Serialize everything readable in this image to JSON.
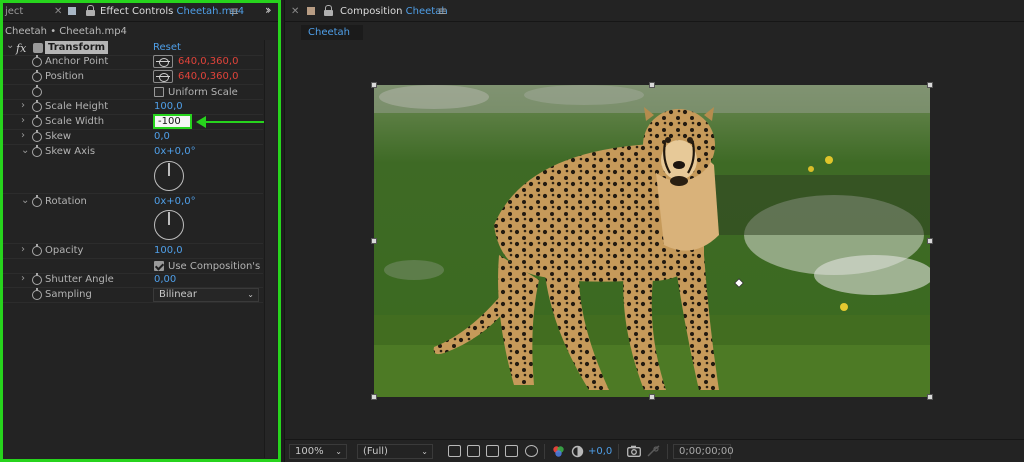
{
  "effect_controls": {
    "tab_project_partial": "ject",
    "tab_prefix": "Effect Controls ",
    "tab_layer": "Cheetah.mp4",
    "layer_header": "Cheetah • Cheetah.mp4",
    "fx_symbol": "fx",
    "effect_name": "Transform",
    "reset_label": "Reset",
    "properties": {
      "anchor_point": {
        "label": "Anchor Point",
        "value": "640,0,360,0"
      },
      "position": {
        "label": "Position",
        "value": "640,0,360,0"
      },
      "uniform_scale": {
        "label": "Uniform Scale",
        "checked": false
      },
      "scale_height": {
        "label": "Scale Height",
        "value": "100,0"
      },
      "scale_width": {
        "label": "Scale Width",
        "value": "-100"
      },
      "skew": {
        "label": "Skew",
        "value": "0,0"
      },
      "skew_axis": {
        "label": "Skew Axis",
        "value": "0x+0,0°"
      },
      "rotation": {
        "label": "Rotation",
        "value": "0x+0,0°"
      },
      "opacity": {
        "label": "Opacity",
        "value": "100,0"
      },
      "use_comp_shutter": {
        "label": "Use Composition's Sh",
        "checked": true
      },
      "shutter_angle": {
        "label": "Shutter Angle",
        "value": "0,00"
      },
      "sampling": {
        "label": "Sampling",
        "value": "Bilinear"
      }
    }
  },
  "composition": {
    "tab_prefix": "Composition ",
    "tab_name": "Cheetah",
    "subtab": "Cheetah"
  },
  "viewer_bar": {
    "zoom": "100%",
    "resolution": "(Full)",
    "exposure": "+0,0",
    "timecode": "0;00;00;00"
  },
  "colors": {
    "highlight": "#27d41d",
    "accent_blue": "#4f9fe8",
    "accent_red": "#e0433a"
  },
  "icons": [
    "close-icon",
    "lock-icon",
    "panel-menu-icon",
    "overflow-chevron-icon",
    "stopwatch-icon",
    "twirl-arrow-icon",
    "target-icon",
    "angle-dial-icon",
    "snapshot-camera-icon",
    "color-picker-icon"
  ]
}
